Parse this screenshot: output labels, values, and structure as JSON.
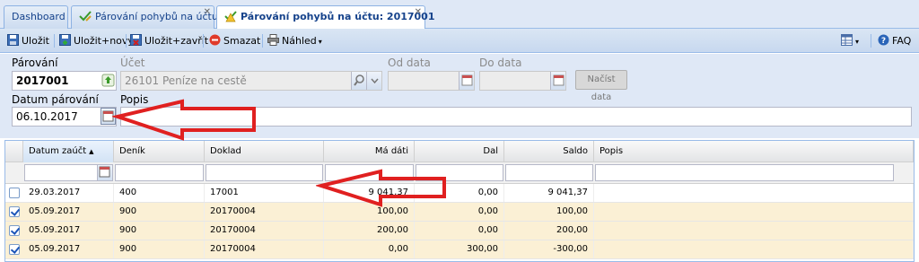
{
  "tabs": [
    {
      "label": "Dashboard",
      "active": false,
      "closable": false
    },
    {
      "label": "Párování pohybů na účtu",
      "active": false,
      "closable": true
    },
    {
      "label": "Párování pohybů na účtu: 2017001",
      "active": true,
      "closable": true
    }
  ],
  "toolbar": {
    "save_label": "Uložit",
    "save_new_label": "Uložit+nový",
    "save_close_label": "Uložit+zavřít",
    "delete_label": "Smazat",
    "preview_label": "Náhled",
    "faq_label": "FAQ"
  },
  "form": {
    "parovani_label": "Párování",
    "parovani_value": "2017001",
    "ucet_label": "Účet",
    "ucet_value": "26101 Peníze na cestě",
    "od_data_label": "Od data",
    "od_data_value": "",
    "do_data_label": "Do data",
    "do_data_value": "",
    "nacist_label": "Načíst data",
    "datum_label": "Datum párování",
    "datum_value": "06.10.2017",
    "popis_label": "Popis",
    "popis_value": ""
  },
  "grid": {
    "columns": [
      "Datum zaúčt",
      "Deník",
      "Doklad",
      "Má dáti",
      "Dal",
      "Saldo",
      "Popis"
    ],
    "rows": [
      {
        "checked": false,
        "datum": "29.03.2017",
        "denik": "400",
        "doklad": "17001",
        "ma_dati": "9 041,37",
        "dal": "0,00",
        "saldo": "9 041,37",
        "popis": ""
      },
      {
        "checked": true,
        "datum": "05.09.2017",
        "denik": "900",
        "doklad": "20170004",
        "ma_dati": "100,00",
        "dal": "0,00",
        "saldo": "100,00",
        "popis": ""
      },
      {
        "checked": true,
        "datum": "05.09.2017",
        "denik": "900",
        "doklad": "20170004",
        "ma_dati": "200,00",
        "dal": "0,00",
        "saldo": "200,00",
        "popis": ""
      },
      {
        "checked": true,
        "datum": "05.09.2017",
        "denik": "900",
        "doklad": "20170004",
        "ma_dati": "0,00",
        "dal": "300,00",
        "saldo": "-300,00",
        "popis": ""
      }
    ]
  },
  "colors": {
    "accent": "#15428b",
    "annotation_arrow": "#e02020",
    "selected_row": "#fbf0d5"
  }
}
